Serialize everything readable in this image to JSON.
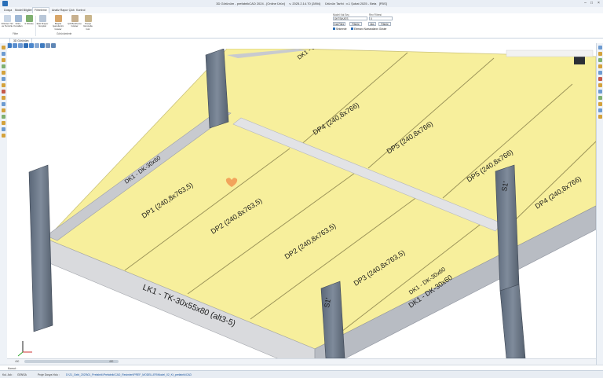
{
  "window": {
    "title": "3D Görünüm - prefabrikCAD 2024 - [Online Ürün]",
    "version": "v. 2025.2.14.70 (2894)",
    "license": "Ürünün Tarihi : v.1 Şubat 2025 - Beta",
    "extra": "[FBS]"
  },
  "menu_tabs": [
    "Dosya",
    "Model Bilgileri",
    "Filtreleme",
    "Analiz Rapor Çıktı",
    "Kontrol"
  ],
  "active_tab": 2,
  "ribbon": {
    "buttons": [
      {
        "label": "Filtreleri Sil ve Temizle"
      },
      {
        "label": "Filtre Kuralları"
      },
      {
        "label": "3 Filtrele"
      },
      {
        "label": "Eski Rapor Gruplar"
      },
      {
        "label": "Başlık İşaretlerini Göster"
      },
      {
        "label": "Çift Belirleme Göster"
      },
      {
        "label": "Parça Güncelle Gör"
      }
    ],
    "groups": [
      "Filtre",
      "Görünümlerle"
    ],
    "filter_label_left": "Model Kat Seç",
    "filter_label_right": "Rev Filtresi",
    "filter_value_left": "DKTS/KATS",
    "filter_value_right": "0",
    "mini_buttons": [
      "Kat Filtre",
      "Filtrele",
      "Aks",
      "Filtrele"
    ],
    "checks": [
      "Sekmede",
      "Elemanı Numaralarını Göster"
    ]
  },
  "document_tab": "3D Görünüm",
  "labels": {
    "dp4_top": "DP4 (240,8x766)",
    "dp5_top": "DP5 (240,8x766)",
    "dp5_right": "DP5 (240,8x766)",
    "dp4_right": "DP4 (240,8x766)",
    "dp1": "DP1 (240,8x763,5)",
    "dp2_left": "DP2 (240,8x763,5)",
    "dp2_right": "DP2 (240,8x763,5)",
    "dp3": "DP3 (240,8x763,5)",
    "dk1_left": "DK1 - DK-30x60",
    "dk1_top": "DK1 - DK-30x60",
    "dk1_right_a": "DK1 - DK-30x60",
    "dk1_right_b": "DK1 - DK-30x60",
    "lk1": "LK1 - TK-30x55x80 (alt3-5)",
    "s1_front": "S1'",
    "s1_right": "S1'"
  },
  "scrollbar": {
    "left_num": "400",
    "right_num": "400"
  },
  "command_line": "Komut :",
  "status": {
    "user_label": "Kul. Adı :",
    "user_value": "GENSA",
    "path_label": "Proje Dosya Yolu :",
    "path_value": "D:\\21_Gebi_2025\\01_Prefabrik\\Prefabrik\\CAD_Resimleri\\PREF_MODELLER\\Model_02_Kt_prefabrik\\CAD"
  },
  "colors": {
    "slab": "#f7ef9c",
    "slab_edge": "#cbc27a",
    "beam": "#d2d3d6",
    "column": "#6e7b8c",
    "accent": "#2a6fb8"
  }
}
